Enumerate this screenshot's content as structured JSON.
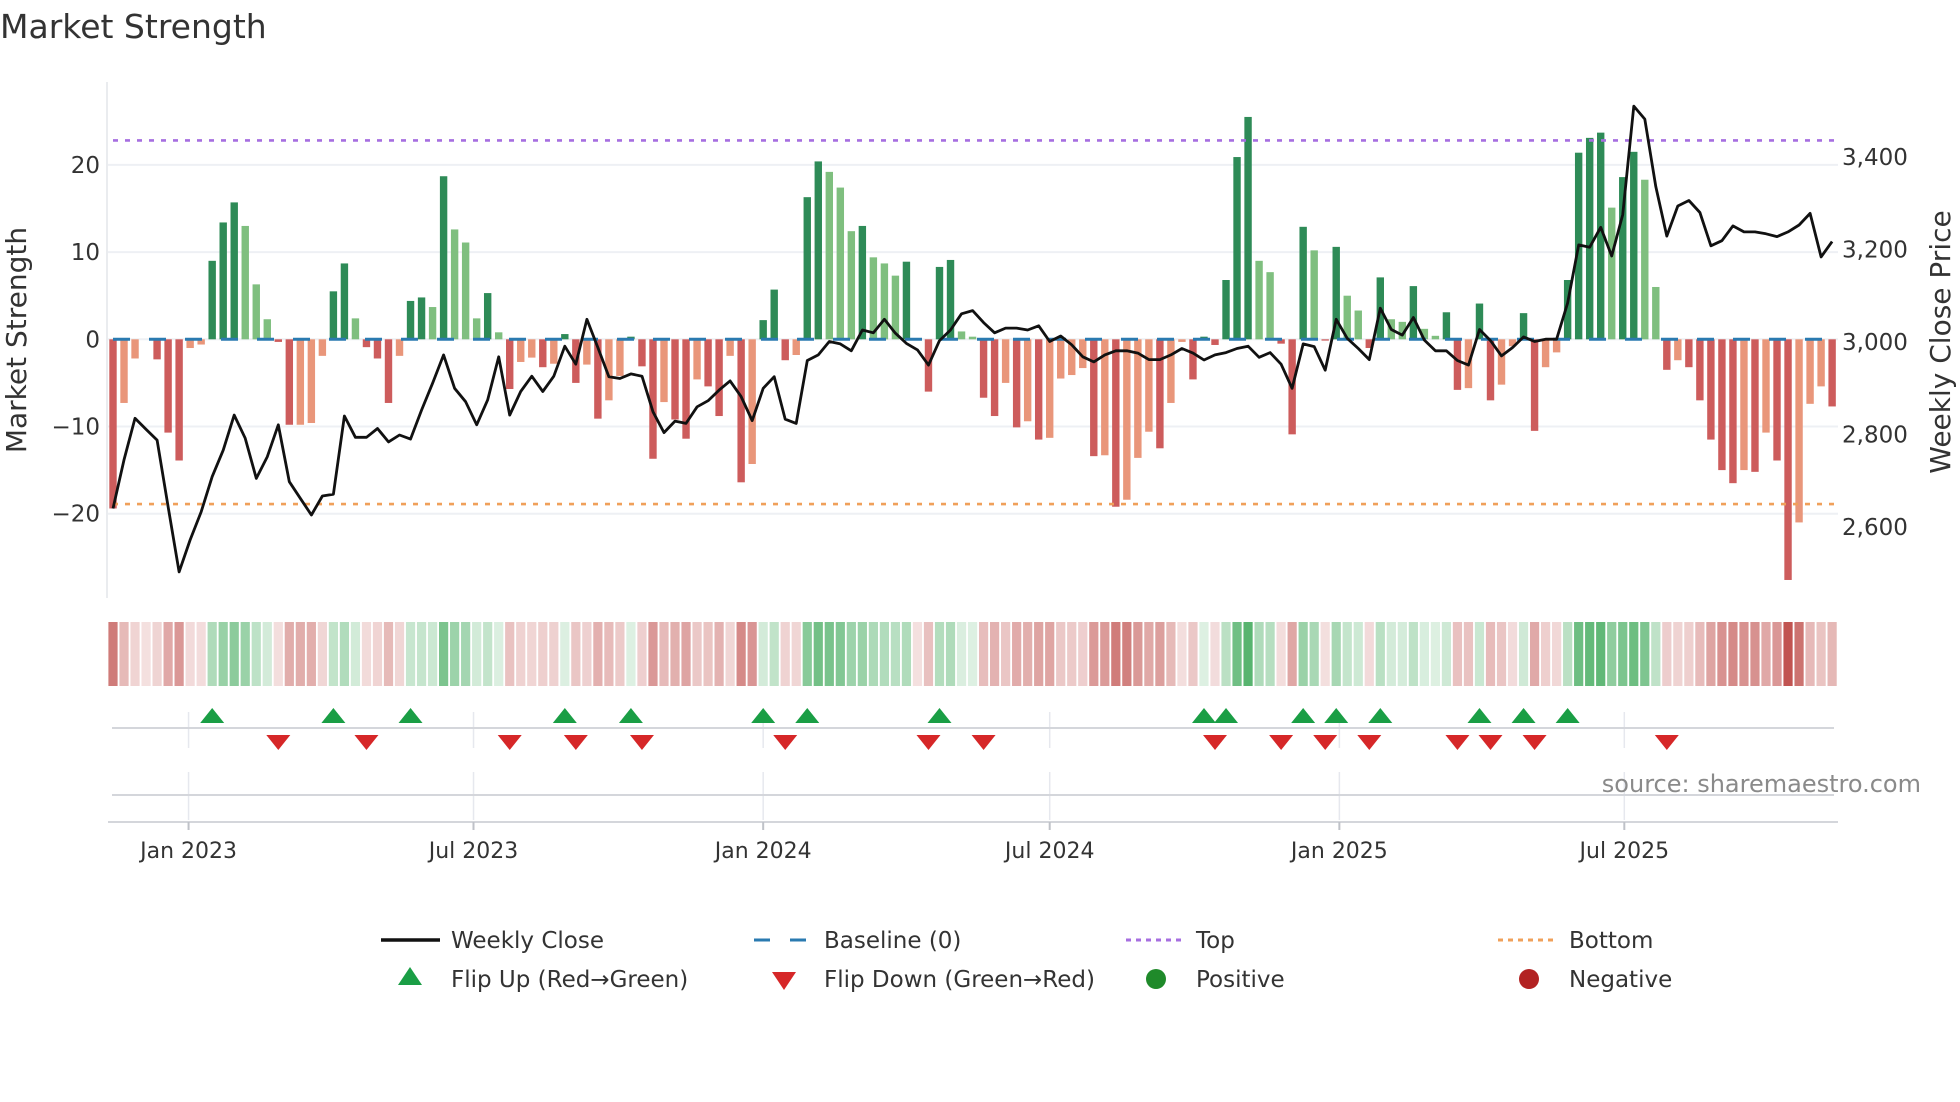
{
  "title": "Market Strength",
  "source": "source: sharemaestro.com",
  "colors": {
    "green_strong": "#2e8b57",
    "green_light": "#7fbf7f",
    "red_strong": "#cd5c5c",
    "red_light": "#e9967a",
    "price_line": "#111111",
    "baseline": "#2a7ab0",
    "top": "#a66ee0",
    "bottom": "#f0a05a",
    "flip_up": "#1a9e45",
    "flip_down": "#d62728",
    "positive": "#1f8a2a",
    "negative": "#b22222",
    "strip_green": "#4caf65",
    "strip_red": "#c0504d"
  },
  "legend": {
    "weekly_close": "Weekly Close",
    "baseline": "Baseline (0)",
    "top": "Top",
    "bottom": "Bottom",
    "flip_up": "Flip Up (Red→Green)",
    "flip_down": "Flip Down (Green→Red)",
    "positive": "Positive",
    "negative": "Negative"
  },
  "chart_data": {
    "type": "bar",
    "title": "Market Strength",
    "ylabel": "Market Strength",
    "y2label": "Weekly Close Price",
    "frequency": "weekly",
    "start_date": "2022-11-14",
    "ylim": [
      -29,
      27
    ],
    "y2lim": [
      2480,
      3530
    ],
    "yticks": [
      {
        "v": 20,
        "label": "20"
      },
      {
        "v": 10,
        "label": "10"
      },
      {
        "v": 0,
        "label": "0"
      },
      {
        "v": -10,
        "label": "−10"
      },
      {
        "v": -20,
        "label": "−20"
      }
    ],
    "y2ticks": [
      {
        "v": 3400,
        "label": "3,400"
      },
      {
        "v": 3200,
        "label": "3,200"
      },
      {
        "v": 3000,
        "label": "3,000"
      },
      {
        "v": 2800,
        "label": "2,800"
      },
      {
        "v": 2600,
        "label": "2,600"
      }
    ],
    "xticks": [
      {
        "date": "2023-01-01",
        "label": "Jan 2023"
      },
      {
        "date": "2023-07-01",
        "label": "Jul 2023"
      },
      {
        "date": "2024-01-01",
        "label": "Jan 2024"
      },
      {
        "date": "2024-07-01",
        "label": "Jul 2024"
      },
      {
        "date": "2025-01-01",
        "label": "Jan 2025"
      },
      {
        "date": "2025-07-01",
        "label": "Jul 2025"
      }
    ],
    "baseline": 0,
    "top_level": 22.8,
    "bottom_level": -18.9,
    "grid": true,
    "legend_position": "bottom",
    "strength": [
      -19.4,
      -7.3,
      -2.2,
      0,
      -2.3,
      -10.7,
      -13.9,
      -1.0,
      -0.6,
      9.0,
      13.4,
      15.7,
      13.0,
      6.3,
      2.3,
      -0.3,
      -9.8,
      -9.8,
      -9.6,
      -1.9,
      5.5,
      8.7,
      2.4,
      -0.9,
      -2.2,
      -7.3,
      -1.9,
      4.4,
      4.8,
      3.7,
      18.7,
      12.6,
      11.1,
      2.4,
      5.3,
      0.8,
      -5.7,
      -2.6,
      -2.1,
      -3.2,
      -2.8,
      0.6,
      -5.0,
      -2.9,
      -9.1,
      -7.0,
      -4.2,
      0.3,
      -3.1,
      -13.7,
      -7.2,
      -9.2,
      -11.4,
      -4.6,
      -5.4,
      -8.8,
      -1.9,
      -16.4,
      -14.3,
      2.2,
      5.7,
      -2.4,
      -1.8,
      16.3,
      20.4,
      19.2,
      17.4,
      12.4,
      13.0,
      9.4,
      8.7,
      7.3,
      8.9,
      0,
      -6.0,
      8.3,
      9.1,
      0.9,
      0.3,
      -6.7,
      -8.8,
      -5.0,
      -10.1,
      -9.4,
      -11.5,
      -11.3,
      -4.5,
      -4.1,
      -3.3,
      -13.4,
      -13.3,
      -19.2,
      -18.4,
      -13.6,
      -10.6,
      -12.5,
      -7.3,
      -0.3,
      -4.6,
      0.3,
      -0.65,
      6.8,
      20.9,
      25.5,
      9.0,
      7.7,
      -0.5,
      -10.9,
      12.9,
      10.2,
      -0.15,
      10.6,
      5.0,
      3.3,
      -1.0,
      7.1,
      2.3,
      2.0,
      6.1,
      1.2,
      0.4,
      3.1,
      -5.8,
      -5.6,
      4.1,
      -7.0,
      -5.2,
      -0.8,
      3.0,
      -10.5,
      -3.2,
      -1.5,
      6.8,
      21.4,
      23.1,
      23.7,
      15.1,
      18.6,
      21.5,
      18.3,
      6.0,
      -3.5,
      -2.4,
      -3.2,
      -7.0,
      -11.5,
      -15.0,
      -16.5,
      -15.0,
      -15.2,
      -10.7,
      -13.9,
      -27.6,
      -21.0,
      -7.4,
      -5.4,
      -7.7
    ],
    "weekly_close": [
      2640,
      2745,
      2835,
      2811,
      2788,
      2644,
      2503,
      2572,
      2633,
      2709,
      2766,
      2842,
      2792,
      2705,
      2752,
      2821,
      2698,
      2662,
      2626,
      2667,
      2671,
      2840,
      2794,
      2794,
      2813,
      2784,
      2799,
      2790,
      2853,
      2911,
      2972,
      2900,
      2871,
      2821,
      2875,
      2968,
      2842,
      2893,
      2926,
      2893,
      2926,
      2991,
      2952,
      3049,
      2988,
      2925,
      2921,
      2931,
      2926,
      2849,
      2804,
      2829,
      2824,
      2860,
      2873,
      2896,
      2916,
      2882,
      2830,
      2900,
      2925,
      2833,
      2824,
      2960,
      2972,
      3001,
      2996,
      2981,
      3026,
      3020,
      3049,
      3019,
      2997,
      2983,
      2950,
      3003,
      3026,
      3061,
      3068,
      3042,
      3020,
      3030,
      3030,
      3026,
      3035,
      3001,
      3013,
      2994,
      2968,
      2957,
      2972,
      2981,
      2981,
      2976,
      2962,
      2962,
      2972,
      2986,
      2976,
      2961,
      2972,
      2977,
      2986,
      2991,
      2967,
      2977,
      2952,
      2900,
      2996,
      2990,
      2939,
      3049,
      3008,
      2986,
      2962,
      3073,
      3027,
      3015,
      3053,
      3004,
      2981,
      2981,
      2960,
      2950,
      3027,
      3003,
      2970,
      2988,
      3011,
      3001,
      3006,
      3006,
      3084,
      3210,
      3205,
      3248,
      3186,
      3275,
      3510,
      3482,
      3336,
      3229,
      3294,
      3306,
      3280,
      3208,
      3219,
      3251,
      3238,
      3238,
      3234,
      3228,
      3238,
      3253,
      3278,
      3184,
      3217
    ]
  }
}
